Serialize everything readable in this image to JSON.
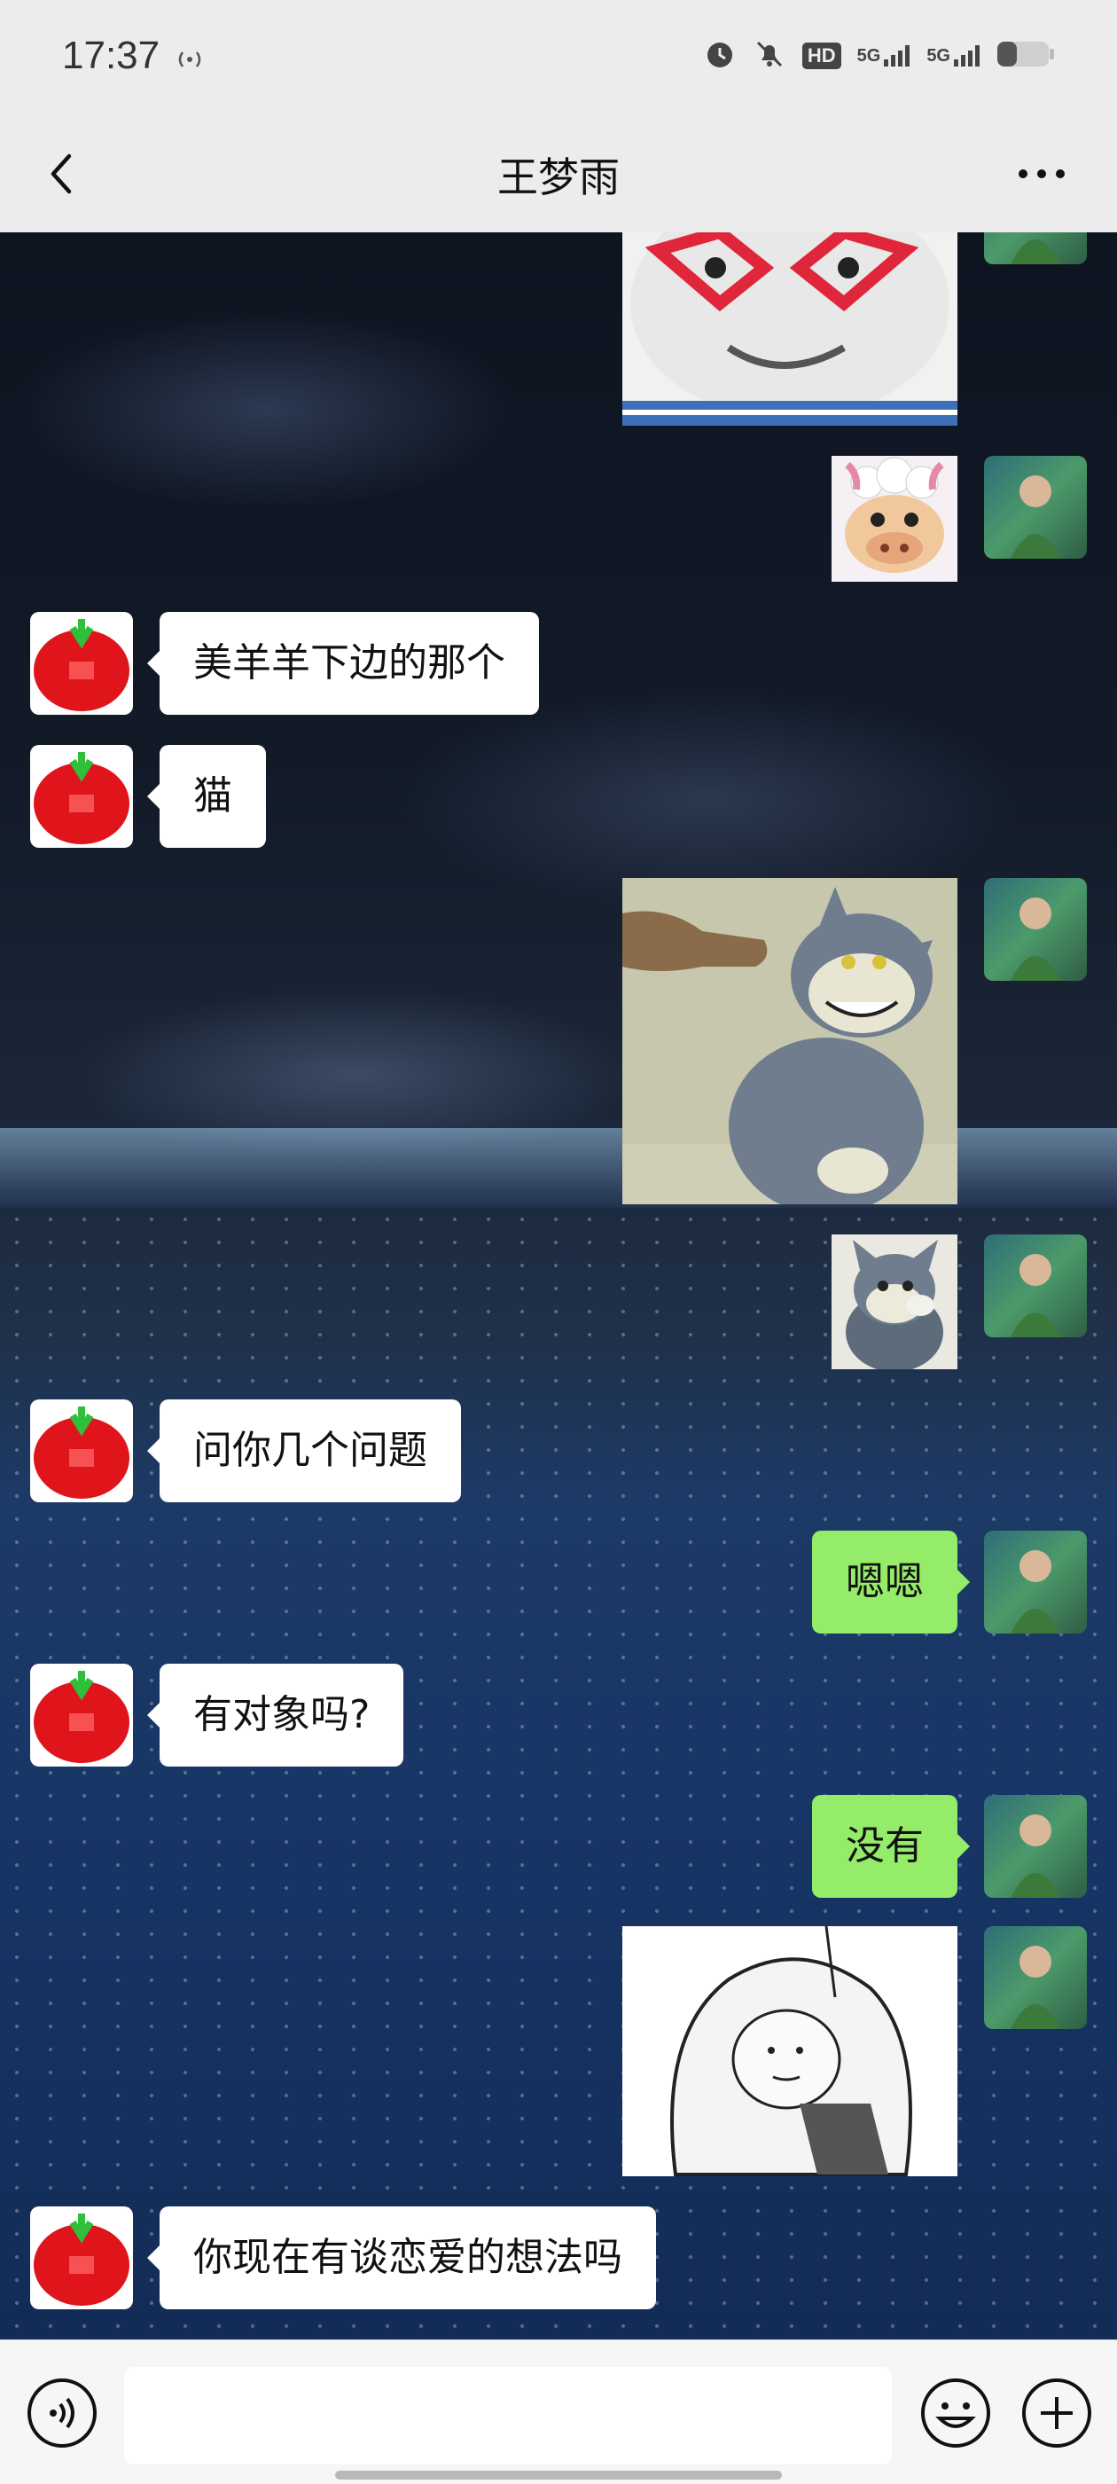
{
  "status": {
    "time": "17:37",
    "hd_label": "HD",
    "net1": "5G",
    "net2": "5G"
  },
  "header": {
    "title": "王梦雨"
  },
  "colors": {
    "self_bubble": "#95ec69",
    "other_bubble": "#ffffff",
    "status_bar": "#ececec"
  },
  "messages": [
    {
      "from": "self",
      "type": "sticker",
      "sticker": "face-with-heart-glasses"
    },
    {
      "from": "self",
      "type": "sticker",
      "sticker": "cartoon-sheep"
    },
    {
      "from": "other",
      "type": "text",
      "text": "美羊羊下边的那个"
    },
    {
      "from": "other",
      "type": "text",
      "text": "猫"
    },
    {
      "from": "self",
      "type": "sticker",
      "sticker": "tom-cat-pointing"
    },
    {
      "from": "self",
      "type": "sticker",
      "sticker": "tom-cat-small"
    },
    {
      "from": "other",
      "type": "text",
      "text": "问你几个问题"
    },
    {
      "from": "self",
      "type": "text",
      "text": "嗯嗯"
    },
    {
      "from": "other",
      "type": "text",
      "text": "有对象吗?"
    },
    {
      "from": "self",
      "type": "text",
      "text": "没有"
    },
    {
      "from": "self",
      "type": "sticker",
      "sticker": "comic-under-blanket"
    },
    {
      "from": "other",
      "type": "text",
      "text": "你现在有谈恋爱的想法吗"
    }
  ],
  "icons": {
    "back": "chevron-left-icon",
    "more": "more-icon",
    "voice": "voice-icon",
    "emoji": "emoji-icon",
    "add": "plus-icon"
  }
}
